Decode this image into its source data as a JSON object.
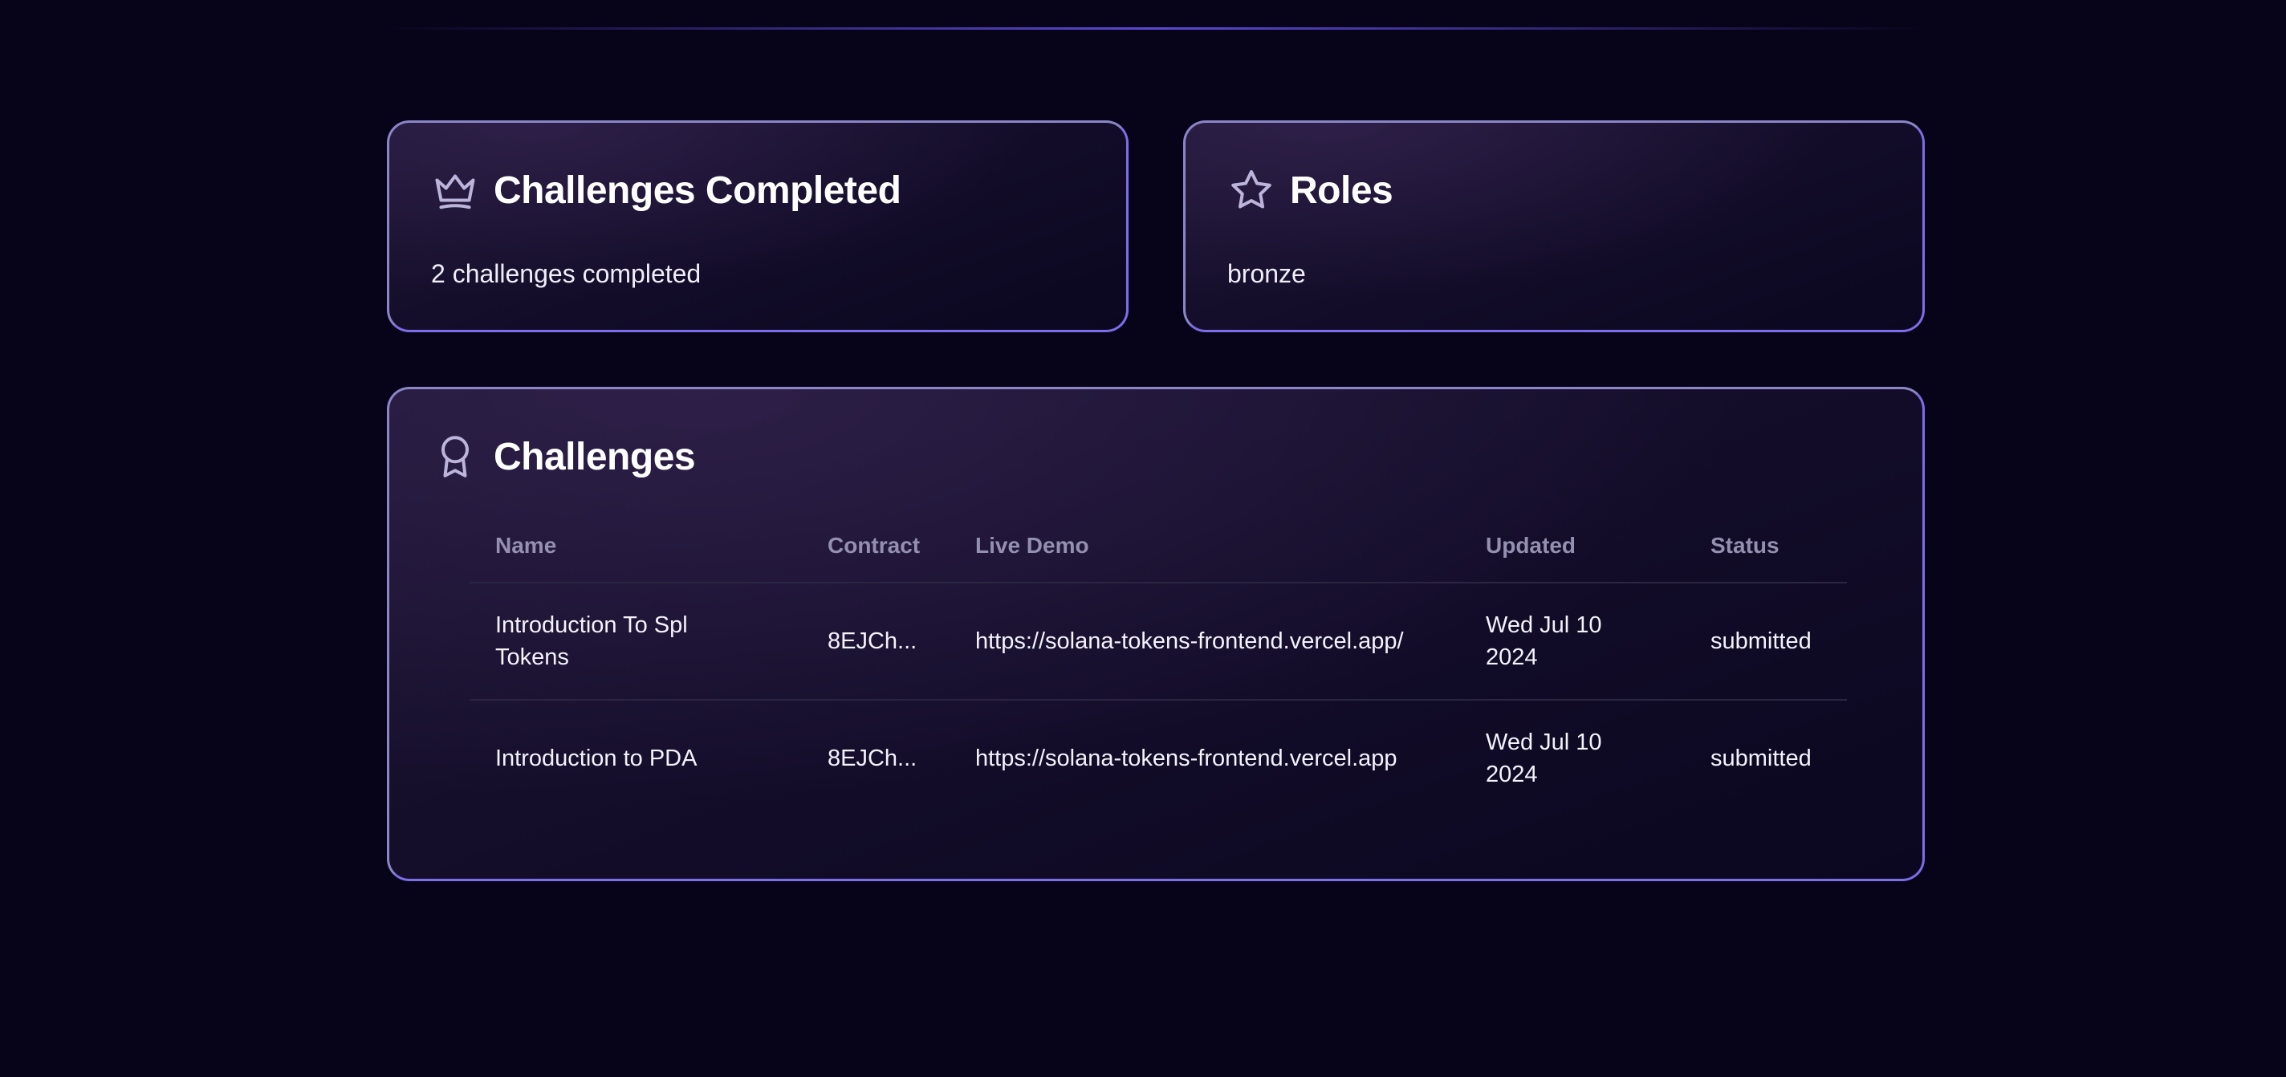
{
  "completed_card": {
    "title": "Challenges Completed",
    "text": "2 challenges completed",
    "icon": "crown-icon"
  },
  "roles_card": {
    "title": "Roles",
    "text": "bronze",
    "icon": "star-icon"
  },
  "challenges_card": {
    "title": "Challenges",
    "icon": "award-icon",
    "columns": [
      "Name",
      "Contract",
      "Live Demo",
      "Updated",
      "Status"
    ],
    "rows": [
      {
        "name": "Introduction To Spl Tokens",
        "contract": "8EJCh...",
        "live_demo": "https://solana-tokens-frontend.vercel.app/",
        "updated": "Wed Jul 10 2024",
        "status": "submitted"
      },
      {
        "name": "Introduction to PDA",
        "contract": "8EJCh...",
        "live_demo": "https://solana-tokens-frontend.vercel.app",
        "updated": "Wed Jul 10 2024",
        "status": "submitted"
      }
    ]
  },
  "colors": {
    "background": "#07041a",
    "border": "#8a86c8",
    "accent": "#7c6de8",
    "muted_text": "#9490b0"
  }
}
